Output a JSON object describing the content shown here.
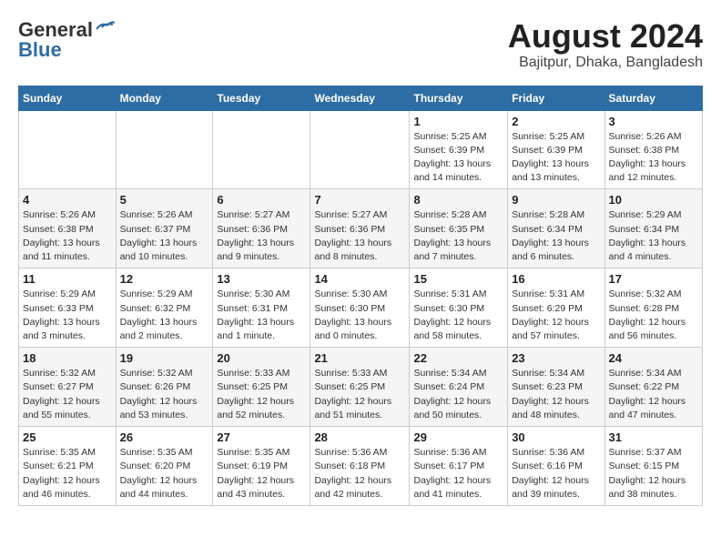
{
  "logo": {
    "line1": "General",
    "line2": "Blue"
  },
  "title": "August 2024",
  "location": "Bajitpur, Dhaka, Bangladesh",
  "days_of_week": [
    "Sunday",
    "Monday",
    "Tuesday",
    "Wednesday",
    "Thursday",
    "Friday",
    "Saturday"
  ],
  "weeks": [
    [
      {
        "day": "",
        "info": ""
      },
      {
        "day": "",
        "info": ""
      },
      {
        "day": "",
        "info": ""
      },
      {
        "day": "",
        "info": ""
      },
      {
        "day": "1",
        "info": "Sunrise: 5:25 AM\nSunset: 6:39 PM\nDaylight: 13 hours\nand 14 minutes."
      },
      {
        "day": "2",
        "info": "Sunrise: 5:25 AM\nSunset: 6:39 PM\nDaylight: 13 hours\nand 13 minutes."
      },
      {
        "day": "3",
        "info": "Sunrise: 5:26 AM\nSunset: 6:38 PM\nDaylight: 13 hours\nand 12 minutes."
      }
    ],
    [
      {
        "day": "4",
        "info": "Sunrise: 5:26 AM\nSunset: 6:38 PM\nDaylight: 13 hours\nand 11 minutes."
      },
      {
        "day": "5",
        "info": "Sunrise: 5:26 AM\nSunset: 6:37 PM\nDaylight: 13 hours\nand 10 minutes."
      },
      {
        "day": "6",
        "info": "Sunrise: 5:27 AM\nSunset: 6:36 PM\nDaylight: 13 hours\nand 9 minutes."
      },
      {
        "day": "7",
        "info": "Sunrise: 5:27 AM\nSunset: 6:36 PM\nDaylight: 13 hours\nand 8 minutes."
      },
      {
        "day": "8",
        "info": "Sunrise: 5:28 AM\nSunset: 6:35 PM\nDaylight: 13 hours\nand 7 minutes."
      },
      {
        "day": "9",
        "info": "Sunrise: 5:28 AM\nSunset: 6:34 PM\nDaylight: 13 hours\nand 6 minutes."
      },
      {
        "day": "10",
        "info": "Sunrise: 5:29 AM\nSunset: 6:34 PM\nDaylight: 13 hours\nand 4 minutes."
      }
    ],
    [
      {
        "day": "11",
        "info": "Sunrise: 5:29 AM\nSunset: 6:33 PM\nDaylight: 13 hours\nand 3 minutes."
      },
      {
        "day": "12",
        "info": "Sunrise: 5:29 AM\nSunset: 6:32 PM\nDaylight: 13 hours\nand 2 minutes."
      },
      {
        "day": "13",
        "info": "Sunrise: 5:30 AM\nSunset: 6:31 PM\nDaylight: 13 hours\nand 1 minute."
      },
      {
        "day": "14",
        "info": "Sunrise: 5:30 AM\nSunset: 6:30 PM\nDaylight: 13 hours\nand 0 minutes."
      },
      {
        "day": "15",
        "info": "Sunrise: 5:31 AM\nSunset: 6:30 PM\nDaylight: 12 hours\nand 58 minutes."
      },
      {
        "day": "16",
        "info": "Sunrise: 5:31 AM\nSunset: 6:29 PM\nDaylight: 12 hours\nand 57 minutes."
      },
      {
        "day": "17",
        "info": "Sunrise: 5:32 AM\nSunset: 6:28 PM\nDaylight: 12 hours\nand 56 minutes."
      }
    ],
    [
      {
        "day": "18",
        "info": "Sunrise: 5:32 AM\nSunset: 6:27 PM\nDaylight: 12 hours\nand 55 minutes."
      },
      {
        "day": "19",
        "info": "Sunrise: 5:32 AM\nSunset: 6:26 PM\nDaylight: 12 hours\nand 53 minutes."
      },
      {
        "day": "20",
        "info": "Sunrise: 5:33 AM\nSunset: 6:25 PM\nDaylight: 12 hours\nand 52 minutes."
      },
      {
        "day": "21",
        "info": "Sunrise: 5:33 AM\nSunset: 6:25 PM\nDaylight: 12 hours\nand 51 minutes."
      },
      {
        "day": "22",
        "info": "Sunrise: 5:34 AM\nSunset: 6:24 PM\nDaylight: 12 hours\nand 50 minutes."
      },
      {
        "day": "23",
        "info": "Sunrise: 5:34 AM\nSunset: 6:23 PM\nDaylight: 12 hours\nand 48 minutes."
      },
      {
        "day": "24",
        "info": "Sunrise: 5:34 AM\nSunset: 6:22 PM\nDaylight: 12 hours\nand 47 minutes."
      }
    ],
    [
      {
        "day": "25",
        "info": "Sunrise: 5:35 AM\nSunset: 6:21 PM\nDaylight: 12 hours\nand 46 minutes."
      },
      {
        "day": "26",
        "info": "Sunrise: 5:35 AM\nSunset: 6:20 PM\nDaylight: 12 hours\nand 44 minutes."
      },
      {
        "day": "27",
        "info": "Sunrise: 5:35 AM\nSunset: 6:19 PM\nDaylight: 12 hours\nand 43 minutes."
      },
      {
        "day": "28",
        "info": "Sunrise: 5:36 AM\nSunset: 6:18 PM\nDaylight: 12 hours\nand 42 minutes."
      },
      {
        "day": "29",
        "info": "Sunrise: 5:36 AM\nSunset: 6:17 PM\nDaylight: 12 hours\nand 41 minutes."
      },
      {
        "day": "30",
        "info": "Sunrise: 5:36 AM\nSunset: 6:16 PM\nDaylight: 12 hours\nand 39 minutes."
      },
      {
        "day": "31",
        "info": "Sunrise: 5:37 AM\nSunset: 6:15 PM\nDaylight: 12 hours\nand 38 minutes."
      }
    ]
  ]
}
